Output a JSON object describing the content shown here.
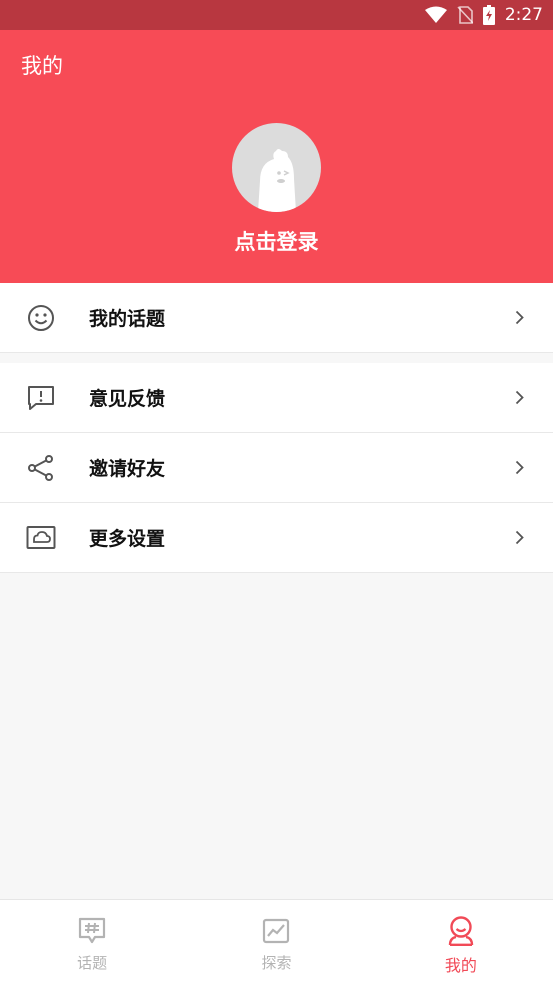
{
  "status_bar": {
    "time": "2:27"
  },
  "header": {
    "title": "我的",
    "login_label": "点击登录"
  },
  "menu": {
    "group1": [
      {
        "label": "我的话题",
        "icon": "smiley-icon"
      }
    ],
    "group2": [
      {
        "label": "意见反馈",
        "icon": "feedback-icon"
      },
      {
        "label": "邀请好友",
        "icon": "share-icon"
      },
      {
        "label": "更多设置",
        "icon": "cloud-settings-icon"
      }
    ]
  },
  "tabbar": {
    "tabs": [
      {
        "label": "话题",
        "icon": "hashtag-chat-icon",
        "active": false
      },
      {
        "label": "探索",
        "icon": "chart-icon",
        "active": false
      },
      {
        "label": "我的",
        "icon": "profile-icon",
        "active": true
      }
    ]
  },
  "colors": {
    "accent": "#f74b56",
    "status_bar": "#b83740",
    "active_tab": "#f14a57",
    "inactive_tab": "#b3b3b3",
    "background": "#f7f7f7"
  }
}
